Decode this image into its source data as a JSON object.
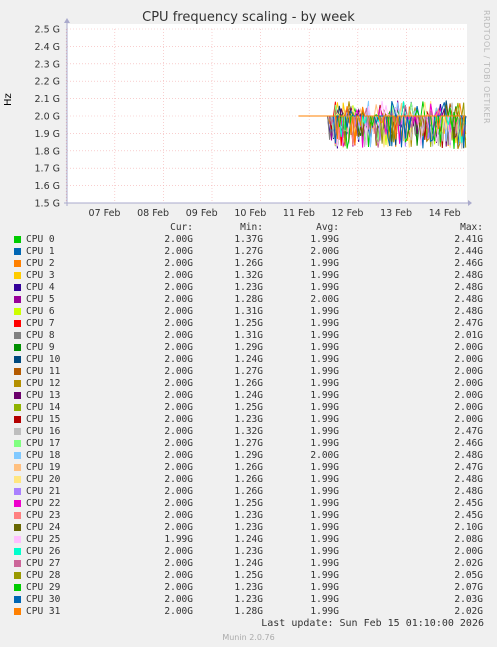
{
  "chart_data": {
    "type": "line",
    "title": "CPU frequency scaling - by week",
    "ylabel": "Hz",
    "ylim": [
      1.5,
      2.5
    ],
    "y_ticks": [
      "1.5 G",
      "1.6 G",
      "1.7 G",
      "1.8 G",
      "1.9 G",
      "2.0 G",
      "2.1 G",
      "2.2 G",
      "2.3 G",
      "2.4 G",
      "2.5 G"
    ],
    "x_ticks": [
      "07 Feb",
      "08 Feb",
      "09 Feb",
      "10 Feb",
      "11 Feb",
      "12 Feb",
      "13 Feb",
      "14 Feb"
    ],
    "data_start_day": 4.3,
    "baseline": 2.0,
    "legend_headers": [
      "Cur:",
      "Min:",
      "Avg:",
      "Max:"
    ],
    "series": [
      {
        "name": "CPU 0",
        "color": "#00cc00",
        "cur": "2.00G",
        "min": "1.37G",
        "avg": "1.99G",
        "max": "2.41G"
      },
      {
        "name": "CPU 1",
        "color": "#0066b3",
        "cur": "2.00G",
        "min": "1.27G",
        "avg": "2.00G",
        "max": "2.44G"
      },
      {
        "name": "CPU 2",
        "color": "#ff8000",
        "cur": "2.00G",
        "min": "1.26G",
        "avg": "1.99G",
        "max": "2.46G"
      },
      {
        "name": "CPU 3",
        "color": "#ffcc00",
        "cur": "2.00G",
        "min": "1.32G",
        "avg": "1.99G",
        "max": "2.48G"
      },
      {
        "name": "CPU 4",
        "color": "#330099",
        "cur": "2.00G",
        "min": "1.23G",
        "avg": "1.99G",
        "max": "2.48G"
      },
      {
        "name": "CPU 5",
        "color": "#990099",
        "cur": "2.00G",
        "min": "1.28G",
        "avg": "2.00G",
        "max": "2.48G"
      },
      {
        "name": "CPU 6",
        "color": "#ccff00",
        "cur": "2.00G",
        "min": "1.31G",
        "avg": "1.99G",
        "max": "2.48G"
      },
      {
        "name": "CPU 7",
        "color": "#ff0000",
        "cur": "2.00G",
        "min": "1.25G",
        "avg": "1.99G",
        "max": "2.47G"
      },
      {
        "name": "CPU 8",
        "color": "#808080",
        "cur": "2.00G",
        "min": "1.31G",
        "avg": "1.99G",
        "max": "2.01G"
      },
      {
        "name": "CPU 9",
        "color": "#008f00",
        "cur": "2.00G",
        "min": "1.29G",
        "avg": "1.99G",
        "max": "2.00G"
      },
      {
        "name": "CPU 10",
        "color": "#00487d",
        "cur": "2.00G",
        "min": "1.24G",
        "avg": "1.99G",
        "max": "2.00G"
      },
      {
        "name": "CPU 11",
        "color": "#b35a00",
        "cur": "2.00G",
        "min": "1.27G",
        "avg": "1.99G",
        "max": "2.00G"
      },
      {
        "name": "CPU 12",
        "color": "#b38f00",
        "cur": "2.00G",
        "min": "1.26G",
        "avg": "1.99G",
        "max": "2.00G"
      },
      {
        "name": "CPU 13",
        "color": "#6b006b",
        "cur": "2.00G",
        "min": "1.24G",
        "avg": "1.99G",
        "max": "2.00G"
      },
      {
        "name": "CPU 14",
        "color": "#8fb300",
        "cur": "2.00G",
        "min": "1.25G",
        "avg": "1.99G",
        "max": "2.00G"
      },
      {
        "name": "CPU 15",
        "color": "#b30000",
        "cur": "2.00G",
        "min": "1.23G",
        "avg": "1.99G",
        "max": "2.00G"
      },
      {
        "name": "CPU 16",
        "color": "#bebebe",
        "cur": "2.00G",
        "min": "1.32G",
        "avg": "1.99G",
        "max": "2.47G"
      },
      {
        "name": "CPU 17",
        "color": "#80ff80",
        "cur": "2.00G",
        "min": "1.27G",
        "avg": "1.99G",
        "max": "2.46G"
      },
      {
        "name": "CPU 18",
        "color": "#80c9ff",
        "cur": "2.00G",
        "min": "1.29G",
        "avg": "2.00G",
        "max": "2.48G"
      },
      {
        "name": "CPU 19",
        "color": "#ffc080",
        "cur": "2.00G",
        "min": "1.26G",
        "avg": "1.99G",
        "max": "2.47G"
      },
      {
        "name": "CPU 20",
        "color": "#ffe680",
        "cur": "2.00G",
        "min": "1.26G",
        "avg": "1.99G",
        "max": "2.48G"
      },
      {
        "name": "CPU 21",
        "color": "#aa80ff",
        "cur": "2.00G",
        "min": "1.26G",
        "avg": "1.99G",
        "max": "2.48G"
      },
      {
        "name": "CPU 22",
        "color": "#ee00cc",
        "cur": "2.00G",
        "min": "1.25G",
        "avg": "1.99G",
        "max": "2.45G"
      },
      {
        "name": "CPU 23",
        "color": "#ff8080",
        "cur": "2.00G",
        "min": "1.23G",
        "avg": "1.99G",
        "max": "2.45G"
      },
      {
        "name": "CPU 24",
        "color": "#666600",
        "cur": "2.00G",
        "min": "1.23G",
        "avg": "1.99G",
        "max": "2.10G"
      },
      {
        "name": "CPU 25",
        "color": "#ffbfff",
        "cur": "1.99G",
        "min": "1.24G",
        "avg": "1.99G",
        "max": "2.08G"
      },
      {
        "name": "CPU 26",
        "color": "#00ffcc",
        "cur": "2.00G",
        "min": "1.23G",
        "avg": "1.99G",
        "max": "2.00G"
      },
      {
        "name": "CPU 27",
        "color": "#cc6699",
        "cur": "2.00G",
        "min": "1.24G",
        "avg": "1.99G",
        "max": "2.02G"
      },
      {
        "name": "CPU 28",
        "color": "#999900",
        "cur": "2.00G",
        "min": "1.25G",
        "avg": "1.99G",
        "max": "2.05G"
      },
      {
        "name": "CPU 29",
        "color": "#00cc00",
        "cur": "2.00G",
        "min": "1.23G",
        "avg": "1.99G",
        "max": "2.07G"
      },
      {
        "name": "CPU 30",
        "color": "#0066b3",
        "cur": "2.00G",
        "min": "1.23G",
        "avg": "1.99G",
        "max": "2.03G"
      },
      {
        "name": "CPU 31",
        "color": "#ff8000",
        "cur": "2.00G",
        "min": "1.28G",
        "avg": "1.99G",
        "max": "2.02G"
      }
    ]
  },
  "side_label": "RRDTOOL / TOBI OETIKER",
  "footer": {
    "last_update": "Last update: Sun Feb 15 01:10:00 2026",
    "munin_version": "Munin 2.0.76"
  }
}
